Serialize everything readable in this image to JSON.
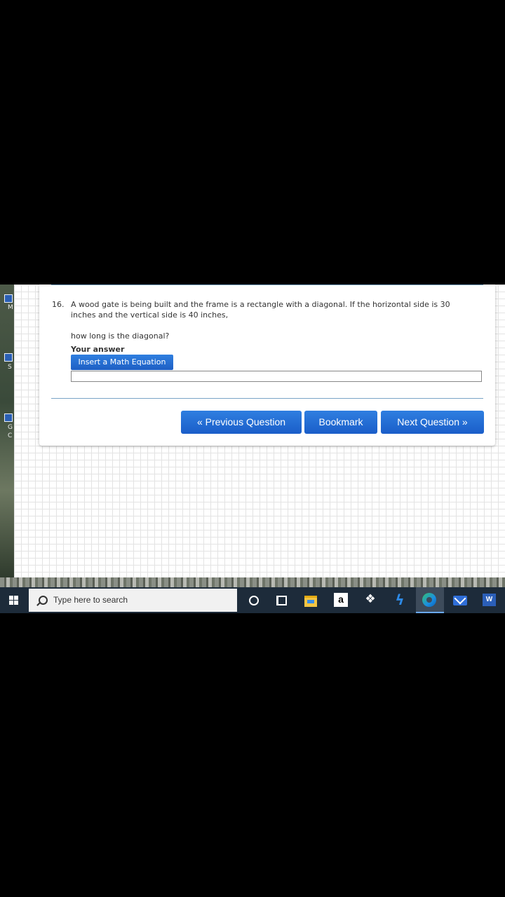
{
  "question": {
    "number": "16.",
    "text": "A wood gate is being built and the frame is a rectangle with a diagonal. If the horizontal side is 30\ninches and the vertical side is 40 inches,",
    "subquestion": "how long is the diagonal?"
  },
  "answer": {
    "label": "Your answer",
    "insert_math_label": "Insert a Math Equation",
    "value": ""
  },
  "navigation": {
    "previous_label": "« Previous Question",
    "bookmark_label": "Bookmark",
    "next_label": "Next Question »"
  },
  "desktop_icons": [
    {
      "label": "M"
    },
    {
      "label": "S"
    },
    {
      "label": "G"
    },
    {
      "label": "C"
    }
  ],
  "taskbar": {
    "search_placeholder": "Type here to search",
    "amazon_letter": "a",
    "word_letter": "W",
    "apps": [
      "cortana-icon",
      "task-view-icon",
      "file-explorer-icon",
      "amazon-icon",
      "dropbox-icon",
      "bolt-app-icon",
      "edge-icon",
      "mail-icon",
      "word-icon"
    ]
  },
  "colors": {
    "button_blue": "#1e66d0",
    "taskbar": "#1d2b3a",
    "rule": "#7aa3c7"
  }
}
